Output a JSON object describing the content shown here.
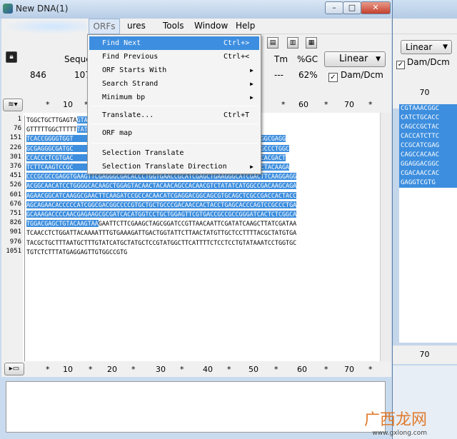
{
  "window": {
    "title": "New DNA(1)",
    "min": "–",
    "max": "□",
    "close": "✕"
  },
  "menubar": {
    "items": [
      "ORFs",
      "ures",
      "Tools",
      "Window",
      "Help"
    ]
  },
  "toolbar": {
    "headers": [
      "Seque",
      "Tm",
      "%GC"
    ],
    "values": [
      "846",
      "107",
      "---",
      "62%"
    ],
    "topology": "Linear",
    "dam_dcm_label": "Dam/Dcm",
    "dam_dcm_checked": true
  },
  "ruler": {
    "ticks": [
      "*",
      "10",
      "*",
      "*",
      "*",
      "*",
      "*",
      "60",
      "*",
      "70",
      "*"
    ]
  },
  "bottom_ruler": {
    "ticks": [
      "*",
      "10",
      "*",
      "20",
      "*",
      "30",
      "*",
      "40",
      "*",
      "50",
      "*",
      "60",
      "*",
      "70",
      "*"
    ]
  },
  "sequence": {
    "lines": [
      {
        "num": "1",
        "plain": "TGGCTGCTTGAGTA",
        "gap": "",
        "selected": "GTAAATTGTCCGCTAAATTCTGGCC"
      },
      {
        "num": "76",
        "plain": "",
        "gap": "GTTTTTGGCTTTTT",
        "selected": "TATGGTGAGCAAGGGCGAGGAGCTGT"
      },
      {
        "num": "151",
        "plain": "",
        "gap": "",
        "selected": "TCACCGGGGTGGT                                  CACAAGTTCAGCGTGTCCGGCGAGG"
      },
      {
        "num": "226",
        "plain": "",
        "gap": "",
        "selected": "GCGAGGGCGATGC                                  CACCGGCAAGCTGCCCGTGCCCTGGC"
      },
      {
        "num": "301",
        "plain": "",
        "gap": "",
        "selected": "CCACCCTCGTGAC                                  CCCGACCACATGAAGCAGCACGACT"
      },
      {
        "num": "376",
        "plain": "",
        "gap": "",
        "selected": "TCTTCAAGTCCGC                                  GTTCAAGGACGACGGCAACTACAAGA"
      },
      {
        "num": "451",
        "plain": "",
        "gap": "",
        "selected": "CCCGCGCCGAGGTGAAGTTCGAGGGCGACACCCTGGTGAACCGCATCGAGCTGAAGGGCATCGACTTCAAGGAGG"
      },
      {
        "num": "526",
        "plain": "",
        "gap": "",
        "selected": "ACGGCAACATCCTGGGGCACAAGCTGGAGTACAACTACAACAGCCACAACGTCTATATCATGGCCGACAAGCAGA"
      },
      {
        "num": "601",
        "plain": "",
        "gap": "",
        "selected": "AGAACGGCATCAAGGCGAACTTCAAGATCCGCCACAACATCGAGGACGGCAGCGTGCAGCTCGCCGACCACTACC"
      },
      {
        "num": "676",
        "plain": "",
        "gap": "",
        "selected": "AGCAGAACACCCCCATCGGCGACGGCCCCGTGCTGCTGCCCGACAACCACTACCTGAGCACCCAGTCCGCCCTGA"
      },
      {
        "num": "751",
        "plain": "",
        "gap": "",
        "selected": "GCAAAGACCCCAACGAGAAGCGCGATCACATGGTCCTGCTGGAGTTCGTGACCGCCGCCGGGATCACTCTCGGCA"
      },
      {
        "num": "826",
        "plain": "GAATTCTTCGAAGCTAGCGGATCCGTTAACAATTCGATATCAAGCTTATCGATAA",
        "gap": "",
        "selected": "TGGACGAGCTGTACAAGTAA"
      },
      {
        "num": "901",
        "plain": "TCAACCTCTGGATTACAAAATTTGTGAAAGATTGACTGGTATTCTTAACTATGTTGCTCCTTTTACGCTATGTGA",
        "gap": "",
        "selected": ""
      },
      {
        "num": "976",
        "plain": "TACGCTGCTTTAATGCTTTGTATCATGCTATGCTCCGTATGGCTTCATTTTCTCCTCCTGTATAAATCCTGGTGC",
        "gap": "",
        "selected": ""
      },
      {
        "num": "1051",
        "plain": "TGTCTCTTTATGAGGAGTTGTGGCCGTG",
        "gap": "",
        "selected": ""
      }
    ]
  },
  "orf_menu": {
    "items": [
      {
        "label": "Find Next",
        "shortcut": "Ctrl+>",
        "submenu": false,
        "highlighted": true
      },
      {
        "label": "Find Previous",
        "shortcut": "Ctrl+<",
        "submenu": false,
        "highlighted": false
      },
      {
        "label": "ORF Starts With",
        "shortcut": "",
        "submenu": true,
        "highlighted": false
      },
      {
        "label": "Search Strand",
        "shortcut": "",
        "submenu": true,
        "highlighted": false
      },
      {
        "label": "Minimum bp",
        "shortcut": "",
        "submenu": true,
        "highlighted": false
      },
      {
        "label": "Translate...",
        "shortcut": "Ctrl+T",
        "submenu": false,
        "highlighted": false
      },
      {
        "label": "ORF map",
        "shortcut": "",
        "submenu": false,
        "highlighted": false
      },
      {
        "label": "Selection Translate",
        "shortcut": "",
        "submenu": false,
        "highlighted": false
      },
      {
        "label": "Selection Translate Direction",
        "shortcut": "",
        "submenu": true,
        "highlighted": false
      }
    ]
  },
  "background_window": {
    "topology": "Linear",
    "dam_dcm_label": "Dam/Dcm",
    "ruler_top": "70",
    "ruler_bottom": "70",
    "sequence_fragments": [
      "CGTAAACGGC",
      "CATCTGCACC",
      "CAGCCGCTAC",
      "CACCATCTTC",
      "CCGCATCGAG",
      "CAGCCACAAC",
      "GGAGGACGGC",
      "CGACAACCAC",
      "GAGGTCGTG"
    ]
  },
  "watermark": {
    "text": "广西龙网",
    "sub": "www.gxlong.com"
  },
  "colors": {
    "selection": "#3d8ede",
    "highlight": "#3d8ee0",
    "chrome": "#f0f0f0"
  }
}
